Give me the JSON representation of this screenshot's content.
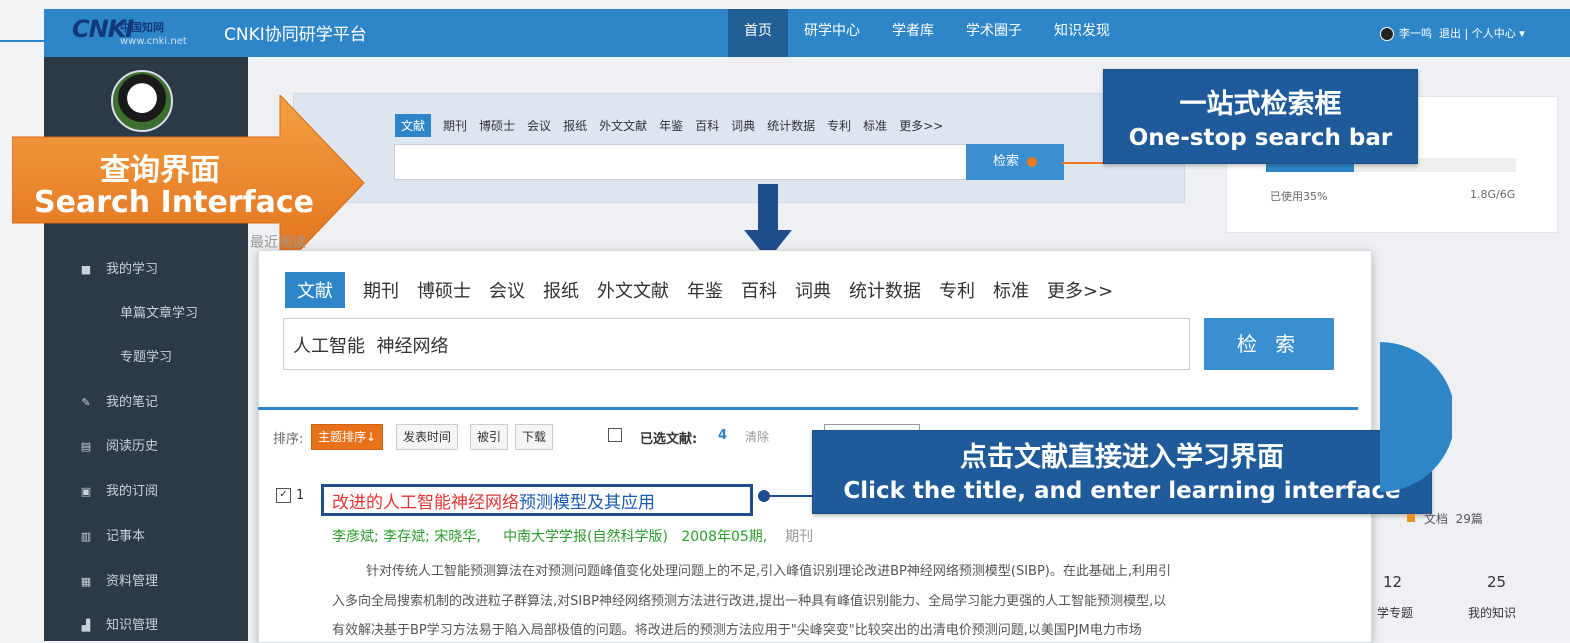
{
  "header": {
    "logo": {
      "text": "CNKI",
      "cn": "中国知网",
      "url": "www.cnki.net"
    },
    "platform_title": "CNKI协同研学平台",
    "nav": [
      {
        "label": "首页",
        "active": true
      },
      {
        "label": "研学中心",
        "active": false
      },
      {
        "label": "学者库",
        "active": false
      },
      {
        "label": "学术圈子",
        "active": false
      },
      {
        "label": "知识发现",
        "active": false
      }
    ],
    "user_name": "李一鸣",
    "logout": "退出",
    "separator": "|",
    "personal_center": "个人中心"
  },
  "sidebar": {
    "items": [
      {
        "label": "我的学习",
        "icon": "book-icon",
        "level": 1
      },
      {
        "label": "单篇文章学习",
        "level": 2
      },
      {
        "label": "专题学习",
        "level": 2
      },
      {
        "label": "我的笔记",
        "icon": "note-icon",
        "level": 1
      },
      {
        "label": "阅读历史",
        "icon": "history-icon",
        "level": 1
      },
      {
        "label": "我的订阅",
        "icon": "subscribe-icon",
        "level": 1
      },
      {
        "label": "记事本",
        "icon": "notebook-icon",
        "level": 1
      },
      {
        "label": "资料管理",
        "icon": "folder-icon",
        "level": 1
      },
      {
        "label": "知识管理",
        "icon": "knowledge-icon",
        "level": 1
      }
    ]
  },
  "search_top": {
    "tabs": [
      "文献",
      "期刊",
      "博硕士",
      "会议",
      "报纸",
      "外文文献",
      "年鉴",
      "百科",
      "词典",
      "统计数据",
      "专利",
      "标准",
      "更多>>"
    ],
    "active_tab": "文献",
    "input_value": "",
    "button_label": "检索"
  },
  "storage": {
    "used_label": "已使用35%",
    "used_fraction": 0.35,
    "size": "1.8G/6G"
  },
  "annotations": {
    "search_box_zh": "一站式检索框",
    "search_box_en": "One-stop search bar",
    "search_interface_zh": "查询界面",
    "search_interface_en": "Search Interface",
    "click_title_zh": "点击文献直接进入学习界面",
    "click_title_en": "Click the title, and enter learning interface"
  },
  "search_zoom": {
    "tabs": [
      "文献",
      "期刊",
      "博硕士",
      "会议",
      "报纸",
      "外文文献",
      "年鉴",
      "百科",
      "词典",
      "统计数据",
      "专利",
      "标准",
      "更多>>"
    ],
    "active_tab": "文献",
    "input_value": "人工智能  神经网络",
    "button_label": "检 索"
  },
  "sort_bar": {
    "label": "排序:",
    "options": [
      "主题排序↓",
      "发表时间",
      "被引",
      "下载"
    ],
    "selected_label": "已选文献:",
    "selected_count": "4",
    "clear": "清除"
  },
  "result": {
    "number": "1",
    "title_highlight": "改进的人工智能神经网络",
    "title_rest": "预测模型及其应用",
    "authors": "李彦斌; 李存斌; 宋晓华,",
    "journal": "中南大学学报(自然科学版)",
    "issue": "2008年05期,",
    "type": "期刊",
    "abstract_lines": [
      "针对传统人工智能预测算法在对预测问题峰值变化处理问题上的不足,引入峰值识别理论改进BP神经网络预测模型(SIBP)。在此基础上,利用引",
      "入多向全局搜索机制的改进粒子群算法,对SIBP神经网络预测方法进行改进,提出一种具有峰值识别能力、全局学习能力更强的人工智能预测模型,以",
      "有效解决基于BP学习方法易于陷入局部极值的问题。将改进后的预测方法应用于\"尖峰突变\"比较突出的出清电价预测问题,以美国PJM电力市场"
    ]
  },
  "right_stats": {
    "legend": "文档  29篇",
    "stats": [
      {
        "value": "12",
        "label": "学专题"
      },
      {
        "value": "25",
        "label": "我的知识"
      }
    ]
  },
  "colors": {
    "accent": "#2e86c9",
    "sidebar": "#2b3a46",
    "callout": "#1f5b9a",
    "orange": "#e8711c"
  }
}
